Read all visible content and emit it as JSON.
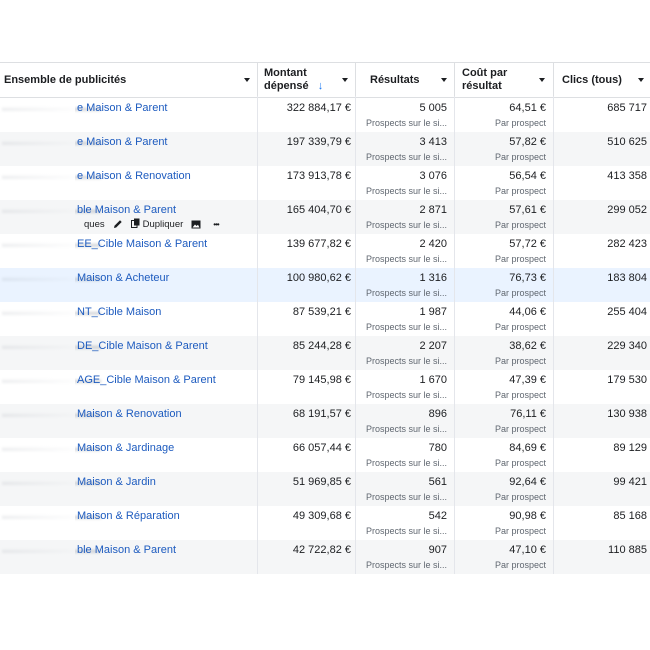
{
  "header": {
    "col_name": "Ensemble de publicités",
    "col_amount_line1": "Montant",
    "col_amount_line2": "dépensé",
    "sort_arrow": "↓",
    "col_results": "Résultats",
    "col_cost_line1": "Coût par",
    "col_cost_line2": "résultat",
    "col_clicks": "Clics (tous)"
  },
  "row_actions": {
    "partial_label": "ques",
    "edit_icon": "pencil-icon",
    "duplicate_label": "Dupliquer",
    "duplicate_icon": "copy-icon",
    "preview_icon": "image-icon",
    "more_icon": "more-icon",
    "more_glyph": "•••"
  },
  "rows": [
    {
      "name": "e Maison & Parent",
      "amount": "322 884,17 €",
      "results": "5 005",
      "results_sub": "Prospects sur le si...",
      "cost": "64,51 €",
      "cost_sub": "Par prospect",
      "clicks": "685 717"
    },
    {
      "name": "e Maison & Parent",
      "amount": "197 339,79 €",
      "results": "3 413",
      "results_sub": "Prospects sur le si...",
      "cost": "57,82 €",
      "cost_sub": "Par prospect",
      "clicks": "510 625"
    },
    {
      "name": "e Maison & Renovation",
      "amount": "173 913,78 €",
      "results": "3 076",
      "results_sub": "Prospects sur le si...",
      "cost": "56,54 €",
      "cost_sub": "Par prospect",
      "clicks": "413 358"
    },
    {
      "name": "ble Maison & Parent",
      "amount": "165 404,70 €",
      "results": "2 871",
      "results_sub": "Prospects sur le si...",
      "cost": "57,61 €",
      "cost_sub": "Par prospect",
      "clicks": "299 052"
    },
    {
      "name": "EE_Cible Maison & Parent",
      "amount": "139 677,82 €",
      "results": "2 420",
      "results_sub": "Prospects sur le si...",
      "cost": "57,72 €",
      "cost_sub": "Par prospect",
      "clicks": "282 423"
    },
    {
      "name": "Maison & Acheteur",
      "amount": "100 980,62 €",
      "results": "1 316",
      "results_sub": "Prospects sur le si...",
      "cost": "76,73 €",
      "cost_sub": "Par prospect",
      "clicks": "183 804"
    },
    {
      "name": "NT_Cible Maison",
      "amount": "87 539,21 €",
      "results": "1 987",
      "results_sub": "Prospects sur le si...",
      "cost": "44,06 €",
      "cost_sub": "Par prospect",
      "clicks": "255 404"
    },
    {
      "name": "DE_Cible Maison & Parent",
      "amount": "85 244,28 €",
      "results": "2 207",
      "results_sub": "Prospects sur le si...",
      "cost": "38,62 €",
      "cost_sub": "Par prospect",
      "clicks": "229 340"
    },
    {
      "name": "AGE_Cible Maison & Parent",
      "amount": "79 145,98 €",
      "results": "1 670",
      "results_sub": "Prospects sur le si...",
      "cost": "47,39 €",
      "cost_sub": "Par prospect",
      "clicks": "179 530"
    },
    {
      "name": "Maison & Renovation",
      "amount": "68 191,57 €",
      "results": "896",
      "results_sub": "Prospects sur le si...",
      "cost": "76,11 €",
      "cost_sub": "Par prospect",
      "clicks": "130 938"
    },
    {
      "name": "Maison & Jardinage",
      "amount": "66 057,44 €",
      "results": "780",
      "results_sub": "Prospects sur le si...",
      "cost": "84,69 €",
      "cost_sub": "Par prospect",
      "clicks": "89 129"
    },
    {
      "name": "Maison & Jardin",
      "amount": "51 969,85 €",
      "results": "561",
      "results_sub": "Prospects sur le si...",
      "cost": "92,64 €",
      "cost_sub": "Par prospect",
      "clicks": "99 421"
    },
    {
      "name": "Maison & Réparation",
      "amount": "49 309,68 €",
      "results": "542",
      "results_sub": "Prospects sur le si...",
      "cost": "90,98 €",
      "cost_sub": "Par prospect",
      "clicks": "85 168"
    },
    {
      "name": "ble Maison & Parent",
      "amount": "42 722,82 €",
      "results": "907",
      "results_sub": "Prospects sur le si...",
      "cost": "47,10 €",
      "cost_sub": "Par prospect",
      "clicks": "110 885"
    }
  ]
}
